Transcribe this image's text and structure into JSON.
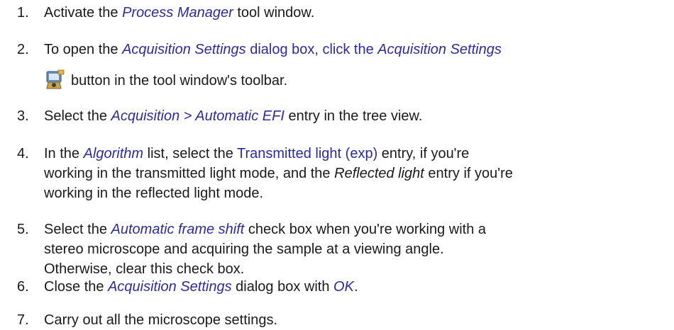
{
  "steps": [
    {
      "number": "1.",
      "parts": [
        "Activate the ",
        "Process Manager",
        " tool window."
      ]
    },
    {
      "number": "2.",
      "parts": [
        "To open the ",
        "Acquisition Settings",
        " dialog box, click the ",
        "Acquisition Settings",
        "button in the tool window's toolbar."
      ],
      "icon": "acquisition-settings-icon"
    },
    {
      "number": "3.",
      "parts": [
        "Select the ",
        "Acquisition > Automatic EFI",
        " entry in the tree view."
      ]
    },
    {
      "number": "4.",
      "parts": [
        "In the ",
        "Algorithm",
        " list, select the ",
        "Transmitted light (exp)",
        " entry, if you're",
        "working in the transmitted light mode, and the ",
        "Reflected light",
        " entry if you're",
        "working in the reflected light mode."
      ]
    },
    {
      "number": "5.",
      "parts": [
        "Select the ",
        "Automatic frame shift",
        " check box when you're working with a",
        "stereo microscope and acquiring the sample at a viewing angle.",
        "Otherwise, clear this check box."
      ]
    },
    {
      "number": "6.",
      "parts": [
        "Close the ",
        "Acquisition Settings",
        " dialog box with ",
        "OK",
        "."
      ]
    },
    {
      "number": "7.",
      "parts": [
        "Carry out all the microscope settings."
      ]
    }
  ]
}
